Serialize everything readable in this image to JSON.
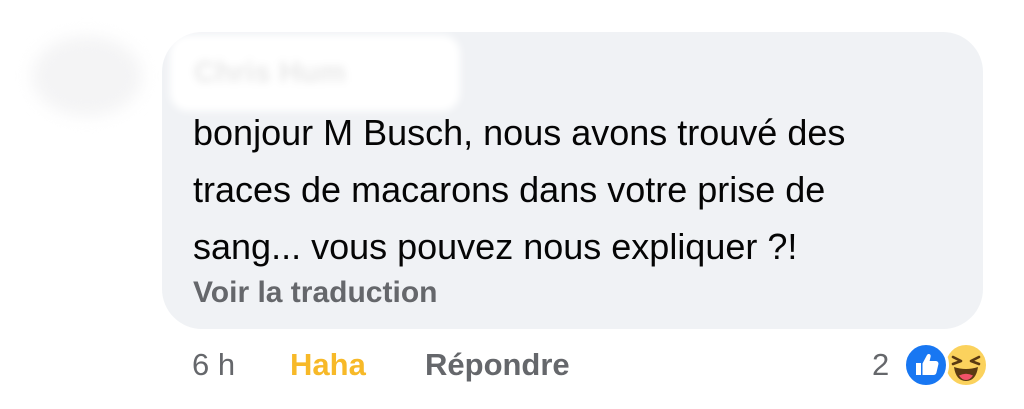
{
  "comment": {
    "author": "Chris Hum",
    "text_lines": [
      "bonjour M Busch, nous avons trouvé des",
      "traces de macarons dans votre prise de",
      "sang... vous pouvez nous expliquer ?!"
    ],
    "translate_label": "Voir la traduction"
  },
  "footer": {
    "timestamp": "6 h",
    "reaction_action": "Haha",
    "reply_label": "Répondre",
    "reaction_count": "2"
  },
  "reactions": {
    "icons": [
      "like-icon",
      "haha-icon"
    ]
  },
  "colors": {
    "bubble": "#f0f2f5",
    "text": "#050505",
    "muted": "#65676b",
    "haha": "#f7b928",
    "like": "#1877f2"
  }
}
